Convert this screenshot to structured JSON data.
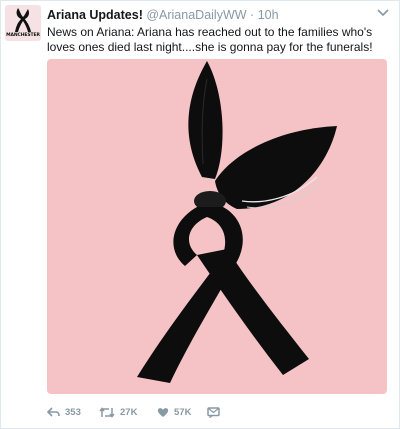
{
  "tweet": {
    "display_name": "Ariana Updates!",
    "handle": "@ArianaDailyWW",
    "separator": "·",
    "time": "10h",
    "text": "News on Ariana: Ariana has reached out to the families who's loves ones died last night....she is gonna pay for the funerals!",
    "avatar_caption": "MANCHESTER"
  },
  "actions": {
    "reply_count": "353",
    "retweet_count": "27K",
    "like_count": "57K"
  },
  "icons": {
    "menu": "chevron-down-icon",
    "reply": "reply-icon",
    "retweet": "retweet-icon",
    "like": "heart-icon",
    "dm": "direct-message-icon"
  },
  "colors": {
    "media_background": "#f5c3c5",
    "ribbon": "#0d0d0d",
    "muted_text": "#8899a6"
  }
}
